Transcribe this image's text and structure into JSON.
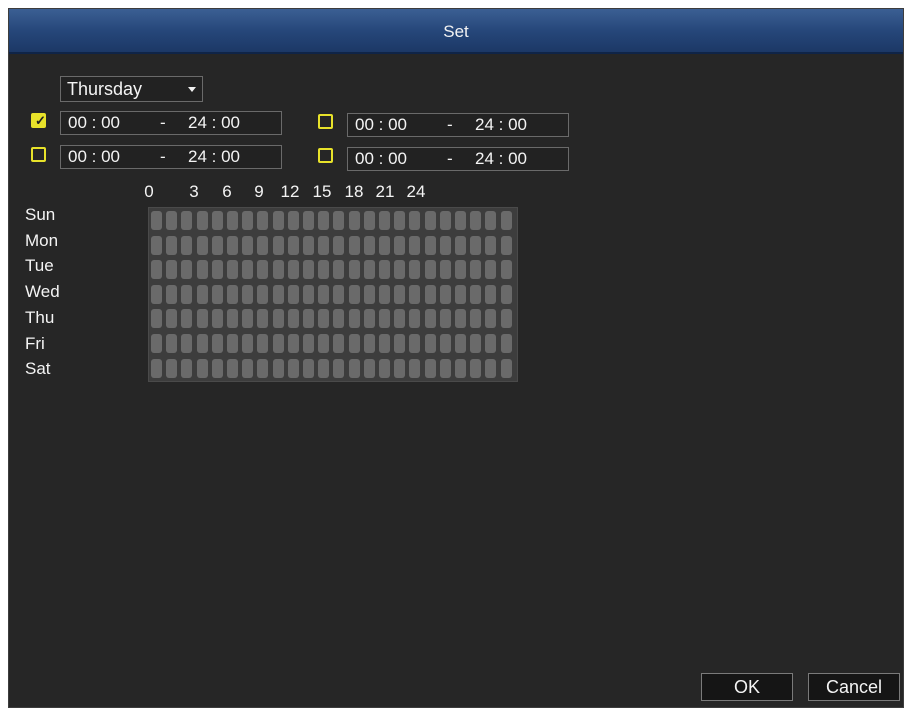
{
  "dialog": {
    "title": "Set"
  },
  "day_select": {
    "value": "Thursday"
  },
  "periods": [
    {
      "checked": true,
      "start": "00 : 00",
      "sep": "-",
      "end": "24 : 00"
    },
    {
      "checked": false,
      "start": "00 : 00",
      "sep": "-",
      "end": "24 : 00"
    },
    {
      "checked": false,
      "start": "00 : 00",
      "sep": "-",
      "end": "24 : 00"
    },
    {
      "checked": false,
      "start": "00 : 00",
      "sep": "-",
      "end": "24 : 00"
    }
  ],
  "schedule": {
    "hour_labels": [
      "0",
      "3",
      "6",
      "9",
      "12",
      "15",
      "18",
      "21",
      "24"
    ],
    "days": [
      "Sun",
      "Mon",
      "Tue",
      "Wed",
      "Thu",
      "Fri",
      "Sat"
    ],
    "slots_per_day": 24
  },
  "buttons": {
    "ok": "OK",
    "cancel": "Cancel"
  },
  "colors": {
    "title_bar": "#26477a",
    "checkbox": "#e8e22a",
    "background": "#262626"
  }
}
